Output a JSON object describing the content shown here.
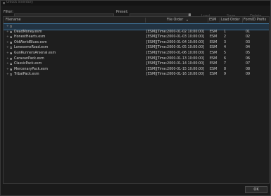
{
  "window": {
    "title": "Unlock inventory"
  },
  "toolbar": {
    "filter_label": "Filter:",
    "filter_value": "",
    "preset_label": "Preset:",
    "preset_value": "",
    "load_label": "Load",
    "save_label": "Save",
    "delete_label": "Delete"
  },
  "table": {
    "headers": {
      "filename": "Filename",
      "file_order": "File Order",
      "esm": "ESM",
      "load_order": "Load Order",
      "formid_prefix": "FormID Prefix"
    },
    "rows": [
      {
        "file": "",
        "order": "",
        "esm": "",
        "load": "",
        "prefix": "",
        "checked": false,
        "selected": true
      },
      {
        "file": "DeadMoney.esm",
        "order": "[ESM][Time:2000-01-02 10:00:00]",
        "esm": "ESM",
        "load": "1",
        "prefix": "01",
        "checked": true,
        "selected": false
      },
      {
        "file": "HonestHearts.esm",
        "order": "[ESM][Time:2000-01-03 10:00:00]",
        "esm": "ESM",
        "load": "2",
        "prefix": "02",
        "checked": true,
        "selected": false
      },
      {
        "file": "OldWorldBlues.esm",
        "order": "[ESM][Time:2000-01-04 10:00:00]",
        "esm": "ESM",
        "load": "3",
        "prefix": "03",
        "checked": true,
        "selected": false
      },
      {
        "file": "LonesomeRoad.esm",
        "order": "[ESM][Time:2000-01-05 10:00:00]",
        "esm": "ESM",
        "load": "4",
        "prefix": "04",
        "checked": true,
        "selected": false
      },
      {
        "file": "GunRunnersArsenal.esm",
        "order": "[ESM][Time:2000-01-06 10:00:00]",
        "esm": "ESM",
        "load": "5",
        "prefix": "05",
        "checked": true,
        "selected": false
      },
      {
        "file": "CaravanPack.esm",
        "order": "[ESM][Time:2000-01-13 10:00:00]",
        "esm": "ESM",
        "load": "6",
        "prefix": "06",
        "checked": true,
        "selected": false
      },
      {
        "file": "ClassicPack.esm",
        "order": "[ESM][Time:2000-01-14 10:00:00]",
        "esm": "ESM",
        "load": "7",
        "prefix": "07",
        "checked": true,
        "selected": false
      },
      {
        "file": "MercenaryPack.esm",
        "order": "[ESM][Time:2000-01-15 10:00:00]",
        "esm": "ESM",
        "load": "8",
        "prefix": "08",
        "checked": true,
        "selected": false
      },
      {
        "file": "TribalPack.esm",
        "order": "[ESM][Time:2000-01-16 10:00:00]",
        "esm": "ESM",
        "load": "9",
        "prefix": "09",
        "checked": true,
        "selected": false
      }
    ]
  },
  "footer": {
    "ok_label": "OK"
  },
  "icons": {
    "expand": "plus-icon",
    "sort": "sort-down-icon"
  }
}
